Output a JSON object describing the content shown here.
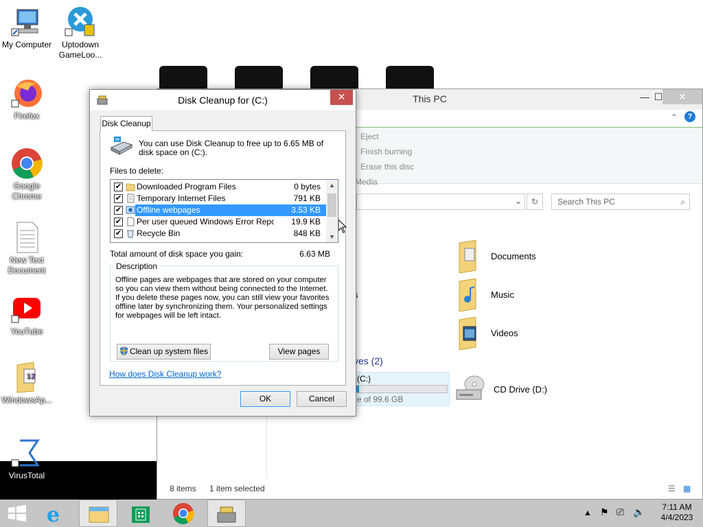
{
  "desktop": {
    "icons": [
      {
        "label": "My Computer",
        "icon": "computer-icon"
      },
      {
        "label": "Uptodown GameLoo...",
        "icon": "uptodown-icon"
      },
      {
        "label": "Firefox",
        "icon": "firefox-icon"
      },
      {
        "label": "Google Chrome",
        "icon": "chrome-icon"
      },
      {
        "label": "New Text Document",
        "icon": "text-document-icon"
      },
      {
        "label": "YouTube",
        "icon": "youtube-icon"
      },
      {
        "label": "WindowsAp...",
        "icon": "folder-icon"
      },
      {
        "label": "VirusTotal",
        "icon": "virustotal-icon"
      }
    ]
  },
  "explorer": {
    "title": "This PC",
    "ribbon": [
      "Eject",
      "Finish burning",
      "Erase this disc",
      "Media"
    ],
    "search_placeholder": "Search This PC",
    "folders": [
      {
        "name": "Documents"
      },
      {
        "name": "Music"
      },
      {
        "name": "Videos"
      }
    ],
    "nav_fragment": "s",
    "drives_header_fragment": "ves (2)",
    "drive_c": {
      "name_fragment": "(C:)",
      "free_fragment": "e of 99.6 GB",
      "used_fraction": 0.03
    },
    "drive_d": {
      "name": "CD Drive (D:)"
    },
    "status_items": "8 items",
    "status_selected": "1 item selected"
  },
  "dialog": {
    "title": "Disk Cleanup for  (C:)",
    "close_glyph": "✕",
    "tab": "Disk Cleanup",
    "intro": "You can use Disk Cleanup to free up to 6.65 MB of disk space on  (C:).",
    "files_label": "Files to delete:",
    "files": [
      {
        "name": "Downloaded Program Files",
        "size": "0 bytes",
        "checked": true,
        "selected": false
      },
      {
        "name": "Temporary Internet Files",
        "size": "791 KB",
        "checked": true,
        "selected": false
      },
      {
        "name": "Offline webpages",
        "size": "3.53 KB",
        "checked": true,
        "selected": true
      },
      {
        "name": "Per user queued Windows Error Repor...",
        "size": "19.9 KB",
        "checked": true,
        "selected": false
      },
      {
        "name": "Recycle Bin",
        "size": "848 KB",
        "checked": true,
        "selected": false
      }
    ],
    "total_label": "Total amount of disk space you gain:",
    "total_value": "6.63 MB",
    "description_legend": "Description",
    "description": "Offline pages are webpages that are stored on your computer so you can view them without being connected to the Internet.  If you delete these pages now, you can still view your favorites offline later by synchronizing them.  Your personalized settings for webpages will be left intact.",
    "cleanup_system_button": "Clean up system files",
    "view_pages_button": "View pages",
    "help_link": "How does Disk Cleanup work?",
    "ok_button": "OK",
    "cancel_button": "Cancel"
  },
  "taskbar": {
    "time": "7:11 AM",
    "date": "4/4/2023"
  },
  "colors": {
    "selection": "#3399ff",
    "close_red": "#c75050",
    "taskbar": "#c6c6c6",
    "link": "#0066cc"
  }
}
